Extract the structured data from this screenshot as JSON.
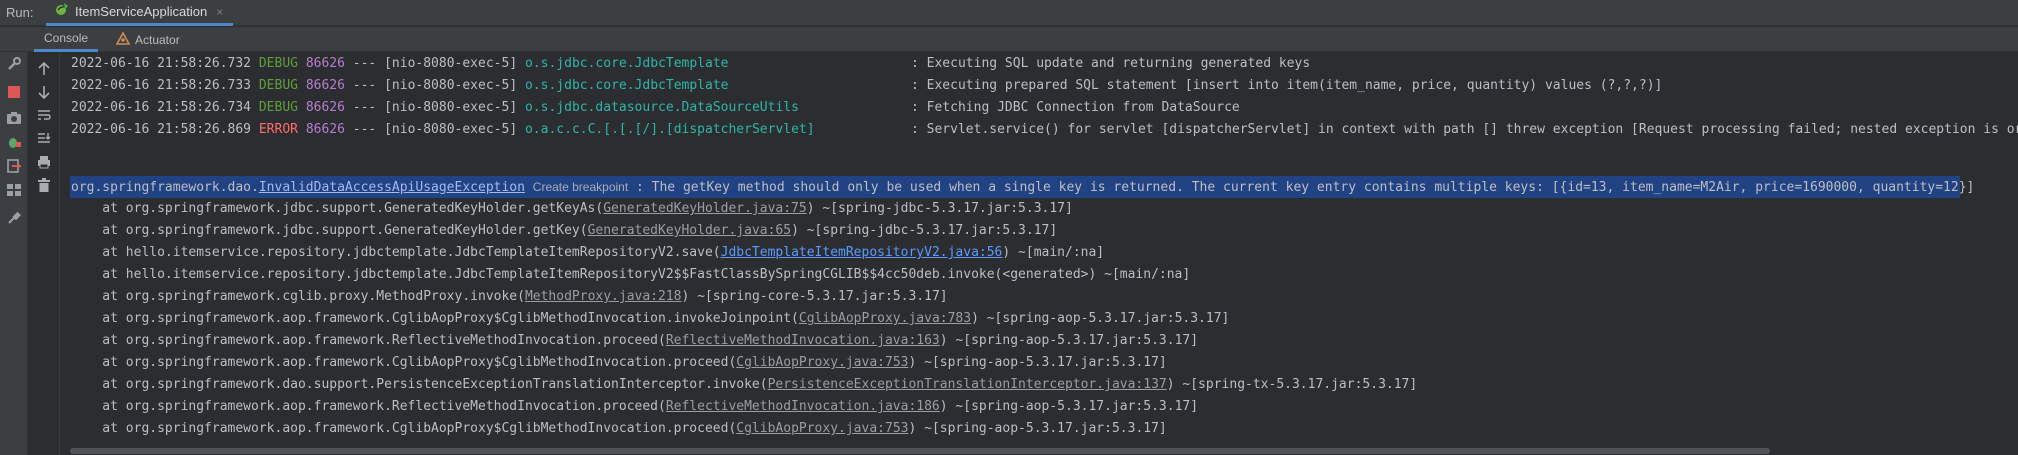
{
  "runbar": {
    "label": "Run:",
    "tab_label": "ItemServiceApplication",
    "close_glyph": "×"
  },
  "tabs": [
    {
      "label": "Console",
      "active": true
    },
    {
      "label": "Actuator",
      "active": false
    }
  ],
  "log_lines": [
    {
      "date": "2022-06-16 21:58:26.732",
      "level": "DEBUG",
      "pid": "86626",
      "sep": "---",
      "thread": "[nio-8080-exec-5]",
      "logger": "o.s.jdbc.core.JdbcTemplate",
      "message": ": Executing SQL update and returning generated keys"
    },
    {
      "date": "2022-06-16 21:58:26.733",
      "level": "DEBUG",
      "pid": "86626",
      "sep": "---",
      "thread": "[nio-8080-exec-5]",
      "logger": "o.s.jdbc.core.JdbcTemplate",
      "message": ": Executing prepared SQL statement [insert into item(item_name, price, quantity) values (?,?,?)]"
    },
    {
      "date": "2022-06-16 21:58:26.734",
      "level": "DEBUG",
      "pid": "86626",
      "sep": "---",
      "thread": "[nio-8080-exec-5]",
      "logger": "o.s.jdbc.datasource.DataSourceUtils",
      "message": ": Fetching JDBC Connection from DataSource"
    },
    {
      "date": "2022-06-16 21:58:26.869",
      "level": "ERROR",
      "pid": "86626",
      "sep": "---",
      "thread": "[nio-8080-exec-5]",
      "logger": "o.a.c.c.C.[.[.[/].[dispatcherServlet]",
      "message": ": Servlet.service() for servlet [dispatcherServlet] in context with path [] threw exception [Request processing failed; nested exception is org.springfr"
    }
  ],
  "exception": {
    "package": "org.springframework.dao.",
    "class_link": "InvalidDataAccessApiUsageException",
    "breakpoint": "Create breakpoint",
    "message": ": The getKey method should only be used when a single key is returned. The current key entry contains multiple keys: [{id=13, item_name=M2Air, price=1690000, quantity=12}]"
  },
  "stack": [
    {
      "prefix": "    at org.springframework.jdbc.support.GeneratedKeyHolder.getKeyAs(",
      "link": "GeneratedKeyHolder.java:75",
      "suffix": ") ~[spring-jdbc-5.3.17.jar:5.3.17]",
      "style": "grey"
    },
    {
      "prefix": "    at org.springframework.jdbc.support.GeneratedKeyHolder.getKey(",
      "link": "GeneratedKeyHolder.java:65",
      "suffix": ") ~[spring-jdbc-5.3.17.jar:5.3.17]",
      "style": "grey"
    },
    {
      "prefix": "    at hello.itemservice.repository.jdbctemplate.JdbcTemplateItemRepositoryV2.save(",
      "link": "JdbcTemplateItemRepositoryV2.java:56",
      "suffix": ") ~[main/:na]",
      "style": "blue"
    },
    {
      "prefix": "    at hello.itemservice.repository.jdbctemplate.JdbcTemplateItemRepositoryV2$$FastClassBySpringCGLIB$$4cc50deb.invoke(<generated>) ~[main/:na]",
      "link": "",
      "suffix": "",
      "style": "none"
    },
    {
      "prefix": "    at org.springframework.cglib.proxy.MethodProxy.invoke(",
      "link": "MethodProxy.java:218",
      "suffix": ") ~[spring-core-5.3.17.jar:5.3.17]",
      "style": "grey"
    },
    {
      "prefix": "    at org.springframework.aop.framework.CglibAopProxy$CglibMethodInvocation.invokeJoinpoint(",
      "link": "CglibAopProxy.java:783",
      "suffix": ") ~[spring-aop-5.3.17.jar:5.3.17]",
      "style": "grey"
    },
    {
      "prefix": "    at org.springframework.aop.framework.ReflectiveMethodInvocation.proceed(",
      "link": "ReflectiveMethodInvocation.java:163",
      "suffix": ") ~[spring-aop-5.3.17.jar:5.3.17]",
      "style": "grey"
    },
    {
      "prefix": "    at org.springframework.aop.framework.CglibAopProxy$CglibMethodInvocation.proceed(",
      "link": "CglibAopProxy.java:753",
      "suffix": ") ~[spring-aop-5.3.17.jar:5.3.17]",
      "style": "grey"
    },
    {
      "prefix": "    at org.springframework.dao.support.PersistenceExceptionTranslationInterceptor.invoke(",
      "link": "PersistenceExceptionTranslationInterceptor.java:137",
      "suffix": ") ~[spring-tx-5.3.17.jar:5.3.17]",
      "style": "grey"
    },
    {
      "prefix": "    at org.springframework.aop.framework.ReflectiveMethodInvocation.proceed(",
      "link": "ReflectiveMethodInvocation.java:186",
      "suffix": ") ~[spring-aop-5.3.17.jar:5.3.17]",
      "style": "grey"
    },
    {
      "prefix": "    at org.springframework.aop.framework.CglibAopProxy$CglibMethodInvocation.proceed(",
      "link": "CglibAopProxy.java:753",
      "suffix": ") ~[spring-aop-5.3.17.jar:5.3.17]",
      "style": "grey"
    }
  ],
  "icons": {
    "runbar": "spring-boot-icon",
    "left_tools": [
      "rerun-icon",
      "wrench-icon",
      "stop-icon",
      "camera-icon",
      "debug-bug-icon",
      "exit-icon",
      "layout-icon",
      "pin-icon"
    ],
    "inner_tools": [
      "arrow-up-icon",
      "arrow-down-icon",
      "soft-wrap-icon",
      "scroll-to-end-icon",
      "print-icon",
      "trash-icon"
    ]
  }
}
